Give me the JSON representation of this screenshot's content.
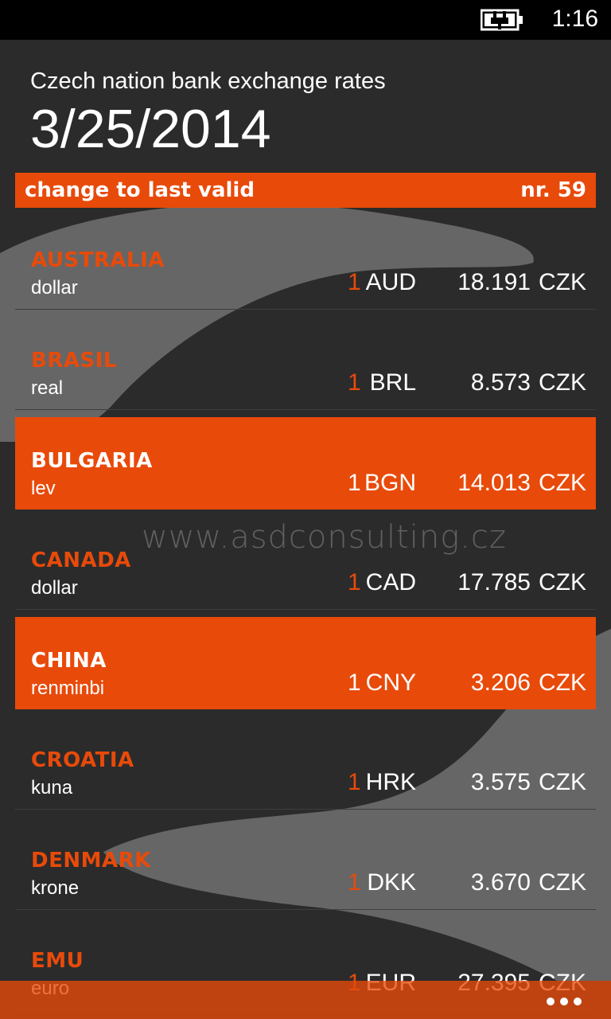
{
  "status_bar": {
    "time": "1:16",
    "battery_icon": "battery-charging-icon"
  },
  "header": {
    "title": "Czech nation bank exchange rates",
    "date": "3/25/2014"
  },
  "info_bar": {
    "left": "change to last valid",
    "right": "nr. 59"
  },
  "rates": [
    {
      "country": "AUSTRALIA",
      "currency": "dollar",
      "amount": "1",
      "code": "AUD",
      "rate": "18.191",
      "unit": "CZK",
      "highlight": false
    },
    {
      "country": "BRASIL",
      "currency": "real",
      "amount": "1",
      "code": "BRL",
      "rate": "8.573",
      "unit": "CZK",
      "highlight": false
    },
    {
      "country": "BULGARIA",
      "currency": "lev",
      "amount": "1",
      "code": "BGN",
      "rate": "14.013",
      "unit": "CZK",
      "highlight": true
    },
    {
      "country": "CANADA",
      "currency": "dollar",
      "amount": "1",
      "code": "CAD",
      "rate": "17.785",
      "unit": "CZK",
      "highlight": false
    },
    {
      "country": "CHINA",
      "currency": "renminbi",
      "amount": "1",
      "code": "CNY",
      "rate": "3.206",
      "unit": "CZK",
      "highlight": true
    },
    {
      "country": "CROATIA",
      "currency": "kuna",
      "amount": "1",
      "code": "HRK",
      "rate": "3.575",
      "unit": "CZK",
      "highlight": false
    },
    {
      "country": "DENMARK",
      "currency": "krone",
      "amount": "1",
      "code": "DKK",
      "rate": "3.670",
      "unit": "CZK",
      "highlight": false
    },
    {
      "country": "EMU",
      "currency": "euro",
      "amount": "1",
      "code": "EUR",
      "rate": "27.395",
      "unit": "CZK",
      "highlight": false
    }
  ],
  "watermark": "www.asdconsulting.cz",
  "app_bar": {
    "more_icon": "more-dots-icon"
  },
  "colors": {
    "accent": "#e84a0a",
    "background": "#2b2b2b",
    "shape": "#6a6a6a"
  }
}
